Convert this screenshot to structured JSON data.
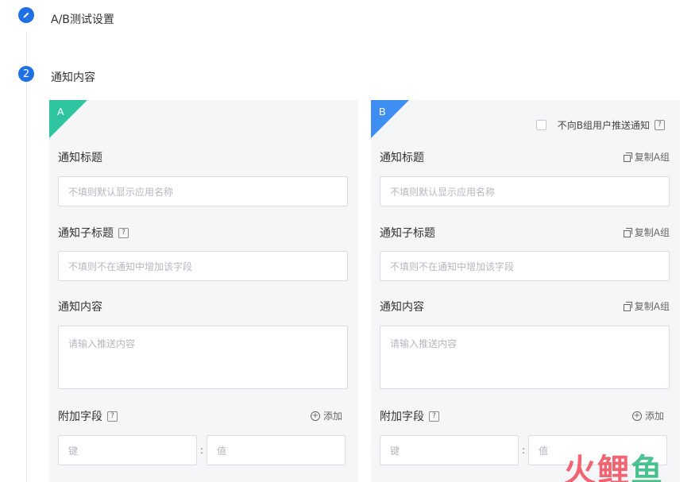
{
  "steps": [
    {
      "title": "A/B测试设置",
      "icon": "pencil-icon"
    },
    {
      "number": "2",
      "title": "通知内容"
    }
  ],
  "panel_a": {
    "letter": "A",
    "title_label": "通知标题",
    "title_placeholder": "不填则默认显示应用名称",
    "subtitle_label": "通知子标题",
    "subtitle_placeholder": "不填则不在通知中增加该字段",
    "content_label": "通知内容",
    "content_placeholder": "请输入推送内容",
    "extra_label": "附加字段",
    "add_label": "添加",
    "key_placeholder": "键",
    "colon": ":",
    "value_placeholder": "值"
  },
  "panel_b": {
    "letter": "B",
    "optout_label": "不向B组用户推送通知",
    "title_label": "通知标题",
    "title_placeholder": "不填则默认显示应用名称",
    "subtitle_label": "通知子标题",
    "subtitle_placeholder": "不填则不在通知中增加该字段",
    "content_label": "通知内容",
    "content_placeholder": "请输入推送内容",
    "copy_label": "复制A组",
    "extra_label": "附加字段",
    "add_label": "添加",
    "key_placeholder": "键",
    "colon": ":",
    "value_placeholder": "值"
  },
  "help_glyph": "?",
  "plus_glyph": "+",
  "watermark": [
    "火",
    "鲤",
    "鱼"
  ],
  "colors": {
    "accent": "#1f6fe5",
    "group_a": "#2ec4a0",
    "group_b": "#3d8ef0"
  }
}
